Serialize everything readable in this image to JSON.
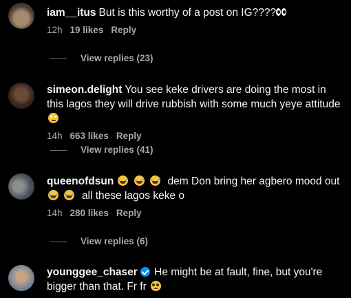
{
  "comments": [
    {
      "username": "iam__itus",
      "text": "But is this worthy of a post on IG????",
      "time": "12h",
      "likes": "19 likes",
      "reply": "Reply",
      "view_replies": "View replies (23)"
    },
    {
      "username": "simeon.delight",
      "text": "You see keke drivers are doing the most in this lagos they will drive rubbish with some much yeye attitude",
      "time": "14h",
      "likes": "663 likes",
      "reply": "Reply",
      "view_replies": "View replies (41)"
    },
    {
      "username": "queenofdsun",
      "text_a": "dem Don bring her agbero mood out",
      "text_b": "all these lagos keke o",
      "time": "14h",
      "likes": "280 likes",
      "reply": "Reply",
      "view_replies": "View replies (6)"
    },
    {
      "username": "younggee_chaser",
      "verified": true,
      "text": "He might be at fault, fine, but you're bigger than that. Fr fr"
    }
  ],
  "icons": {
    "eyes": "eyes-emoji",
    "face_rolling_eyes": "face-with-rolling-eyes-emoji",
    "laughing": "face-with-tears-of-joy-emoji",
    "pleading": "pleading-face-emoji",
    "verified": "verified-badge-icon"
  },
  "colors": {
    "background": "#000000",
    "text": "#f5f5f5",
    "secondary": "#a8a8a8",
    "verified": "#0095f6"
  }
}
